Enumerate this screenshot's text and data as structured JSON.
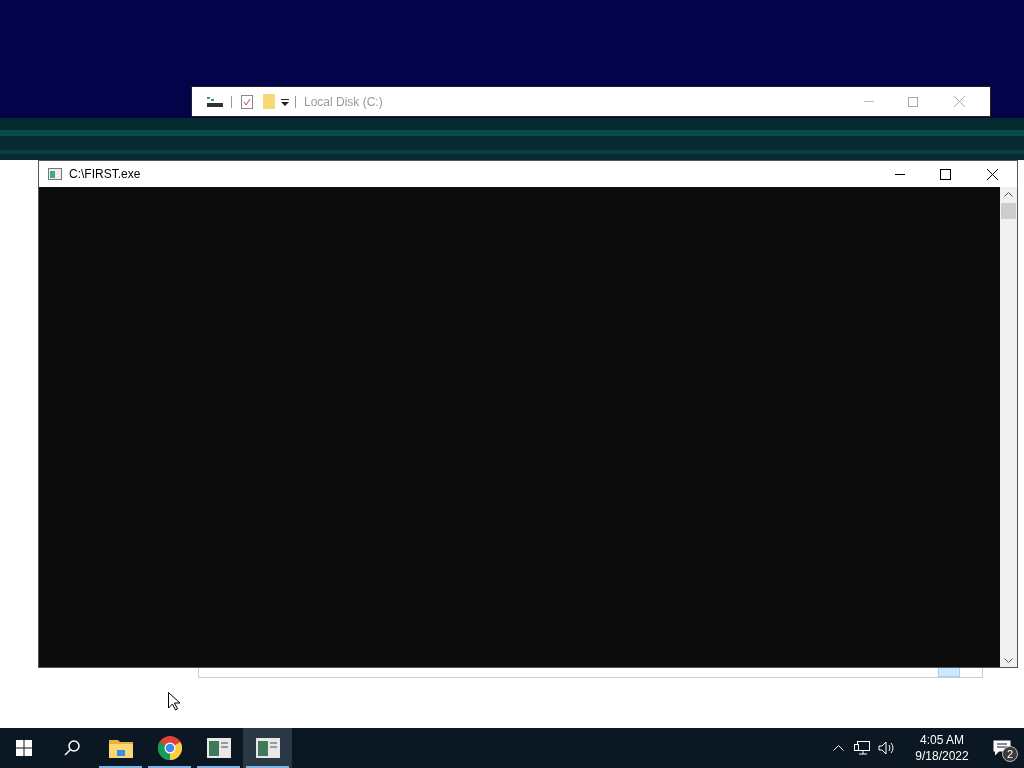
{
  "background_window": {
    "title": "Local Disk (C:)"
  },
  "console_window": {
    "title": "C:\\FIRST.exe"
  },
  "taskbar": {
    "apps": [
      {
        "kind": "explorer",
        "selected": false
      },
      {
        "kind": "chrome",
        "selected": false
      },
      {
        "kind": "app",
        "selected": false
      },
      {
        "kind": "app",
        "selected": true
      }
    ],
    "clock": {
      "time": "4:05 AM",
      "date": "9/18/2022"
    },
    "notification_count": "2"
  }
}
